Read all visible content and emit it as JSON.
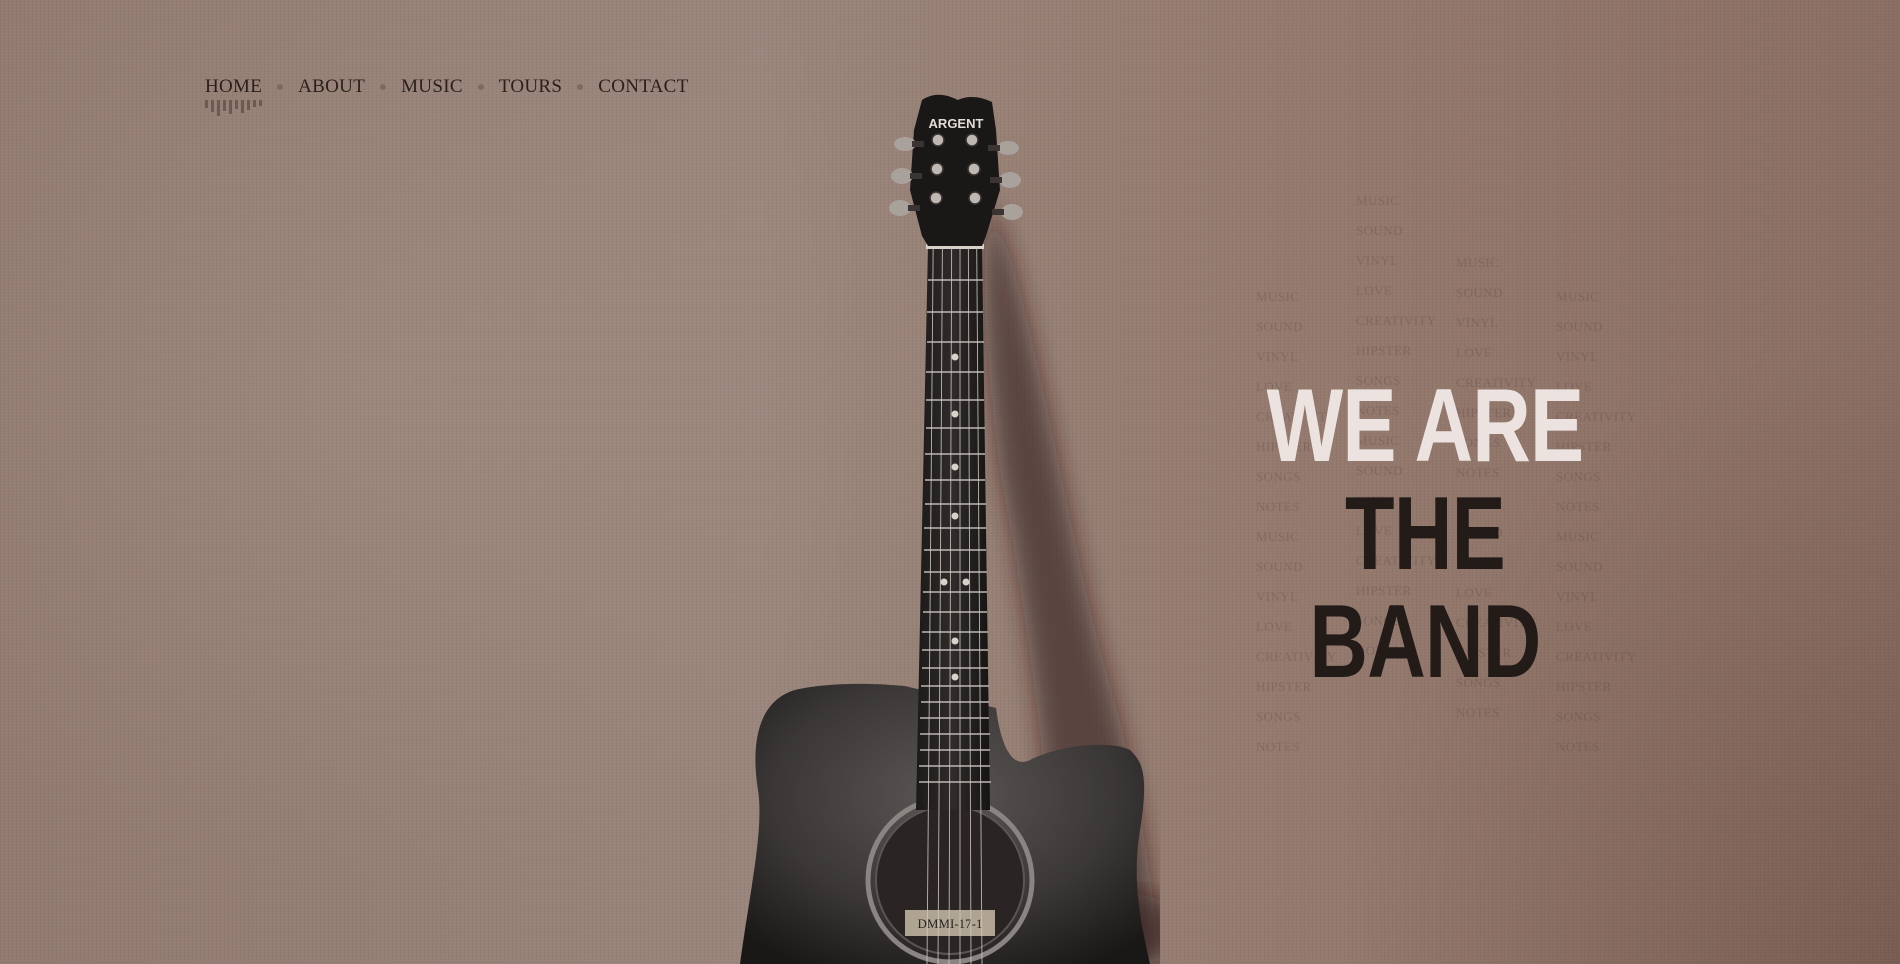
{
  "nav": {
    "items": [
      {
        "label": "HOME"
      },
      {
        "label": "ABOUT"
      },
      {
        "label": "MUSIC"
      },
      {
        "label": "TOURS"
      },
      {
        "label": "CONTACT"
      }
    ]
  },
  "hero": {
    "line1": "WE ARE",
    "line2": "THE BAND"
  },
  "guitar": {
    "headstock_brand": "ARGENT",
    "soundhole_label": "DMMI-17-1"
  },
  "word_cloud": {
    "columns": [
      [
        "MUSIC",
        "SOUND",
        "VINYL",
        "LOVE",
        "CREATIVITY",
        "HIPSTER",
        "SONGS",
        "NOTES",
        "MUSIC",
        "SOUND",
        "VINYL",
        "LOVE",
        "CREATIVITY",
        "HIPSTER",
        "SONGS",
        "NOTES"
      ],
      [
        "MUSIC",
        "SOUND",
        "VINYL",
        "LOVE",
        "CREATIVITY",
        "HIPSTER",
        "SONGS",
        "NOTES",
        "MUSIC",
        "SOUND",
        "VINYL",
        "LOVE",
        "CREATIVITY",
        "HIPSTER",
        "SONGS",
        "NOTES"
      ],
      [
        "MUSIC",
        "SOUND",
        "VINYL",
        "LOVE",
        "CREATIVITY",
        "HIPSTER",
        "SONGS",
        "NOTES",
        "MUSIC",
        "SOUND",
        "VINYL",
        "LOVE",
        "CREATIVITY",
        "HIPSTER",
        "SONGS",
        "NOTES"
      ],
      [
        "MUSIC",
        "SOUND",
        "VINYL",
        "LOVE",
        "CREATIVITY",
        "HIPSTER",
        "SONGS",
        "NOTES",
        "MUSIC",
        "SOUND",
        "VINYL",
        "LOVE",
        "CREATIVITY",
        "HIPSTER",
        "SONGS",
        "NOTES"
      ]
    ]
  },
  "colors": {
    "background": "#957f75",
    "nav_text": "#2a1f1b",
    "hero_light": "#ece3e0",
    "hero_dark": "#231b18"
  }
}
